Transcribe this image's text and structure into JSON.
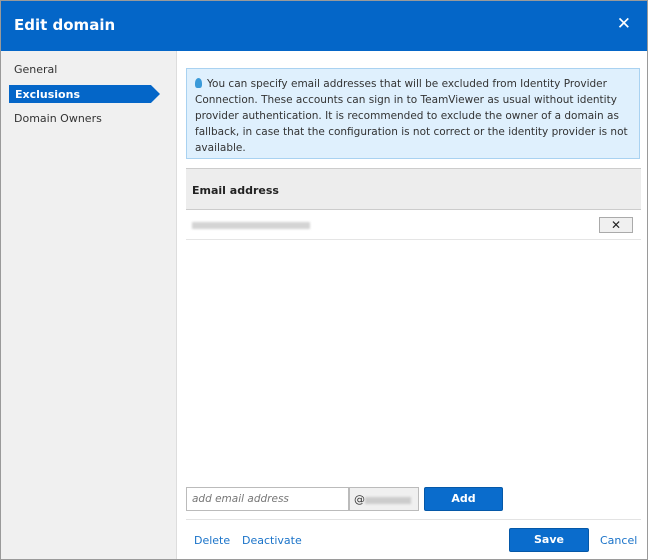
{
  "dialog": {
    "title": "Edit domain",
    "close": "✕"
  },
  "sidebar": {
    "items": [
      {
        "label": "General"
      },
      {
        "label": "Exclusions"
      },
      {
        "label": "Domain Owners"
      }
    ]
  },
  "info": {
    "text": "You can specify email addresses that will be excluded from Identity Provider Connection. These accounts can sign in to TeamViewer as usual without identity provider authentication. It is recommended to exclude the owner of a domain as fallback, in case that the configuration is not correct or the identity provider is not available."
  },
  "table": {
    "header": "Email address",
    "remove": "✕"
  },
  "form": {
    "placeholder": "add email address",
    "at": "@",
    "add": "Add"
  },
  "footer": {
    "delete": "Delete",
    "deactivate": "Deactivate",
    "save": "Save",
    "cancel": "Cancel"
  }
}
